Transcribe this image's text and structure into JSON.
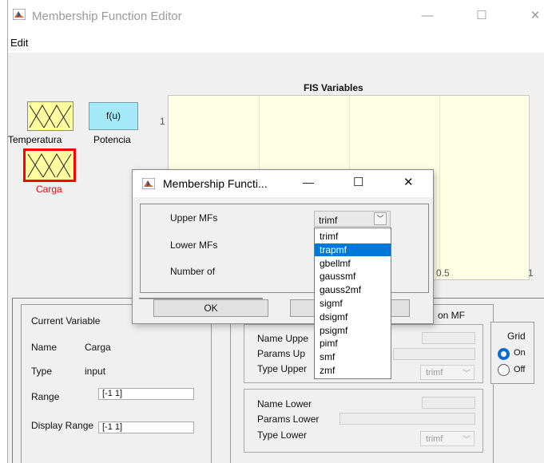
{
  "window": {
    "title": "Membership Function Editor",
    "menu_edit": "Edit"
  },
  "variables": {
    "temperatura": "Temperatura",
    "potencia": "Potencia",
    "potencia_func": "f(u)",
    "carga": "Carga"
  },
  "plot": {
    "title": "FIS Variables",
    "y_tick": "1",
    "x_ticks": [
      "0.5",
      "1"
    ]
  },
  "current_variable": {
    "header": "Current Variable",
    "name_label": "Name",
    "name_value": "Carga",
    "type_label": "Type",
    "type_value": "input",
    "range_label": "Range",
    "range_value": "[-1 1]",
    "display_range_label": "Display Range",
    "display_range_value": "[-1 1]"
  },
  "mf_panel": {
    "header_fragment": "on MF",
    "name_upper": "Name Uppe",
    "params_upper": "Params Up",
    "type_upper": "Type Upper",
    "upper_combo": "trimf",
    "name_lower": "Name Lower",
    "params_lower": "Params Lower",
    "type_lower": "Type Lower",
    "lower_combo": "trimf"
  },
  "grid": {
    "label": "Grid",
    "on": "On",
    "off": "Off",
    "selected": "On"
  },
  "dialog": {
    "title": "Membership Functi...",
    "upper_label": "Upper MFs",
    "lower_label": "Lower MFs",
    "number_label": "Number of",
    "ok": "OK",
    "selected_value": "trimf",
    "options": [
      "trimf",
      "trapmf",
      "gbellmf",
      "gaussmf",
      "gauss2mf",
      "sigmf",
      "dsigmf",
      "psigmf",
      "pimf",
      "smf",
      "zmf"
    ],
    "highlighted_option": "trapmf"
  },
  "colors": {
    "input_mf": "#ffffa0",
    "output_func": "#a3e9f7",
    "selected_border": "#ff0000",
    "highlight": "#0078d7",
    "plot_bg": "#ffffe5"
  }
}
